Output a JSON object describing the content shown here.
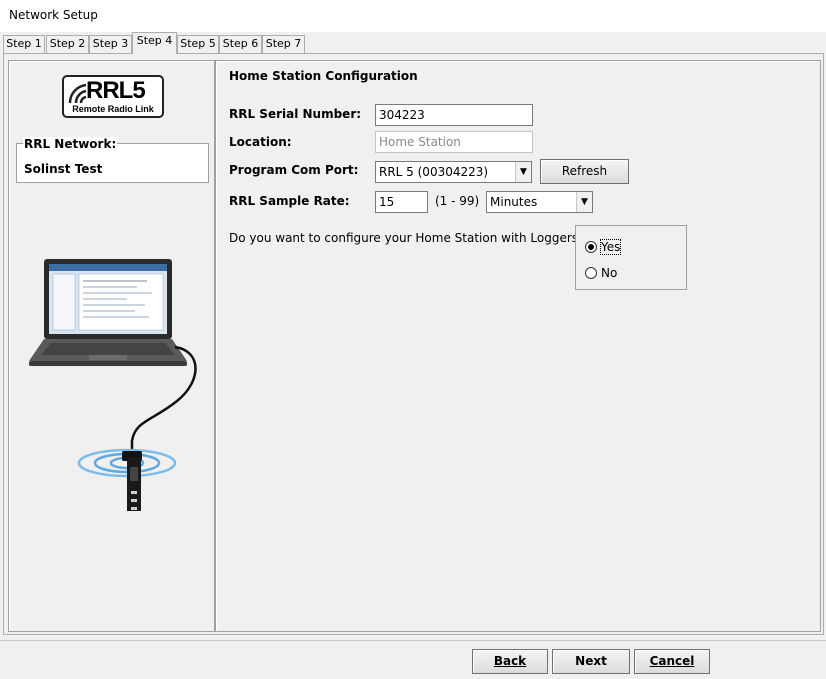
{
  "window": {
    "title": "Network Setup"
  },
  "tabs": [
    {
      "label": "Step 1"
    },
    {
      "label": "Step 2"
    },
    {
      "label": "Step 3"
    },
    {
      "label": "Step 4"
    },
    {
      "label": "Step 5"
    },
    {
      "label": "Step 6"
    },
    {
      "label": "Step 7"
    }
  ],
  "active_tab": "Step 4",
  "left": {
    "logo": {
      "main": "RRL5",
      "sub": "Remote Radio Link"
    },
    "network_label": "RRL Network:",
    "network_value": "Solinst Test"
  },
  "form": {
    "section_title": "Home Station Configuration",
    "serial": {
      "label": "RRL Serial Number:",
      "value": "304223"
    },
    "location": {
      "label": "Location:",
      "placeholder": "Home Station"
    },
    "com_port": {
      "label": "Program Com Port:",
      "value": "RRL 5 (00304223)",
      "refresh_label": "Refresh"
    },
    "sample_rate": {
      "label": "RRL Sample Rate:",
      "value": "15",
      "range": "(1 - 99)",
      "unit": "Minutes"
    },
    "loggers_question": "Do you want to configure your Home Station with Loggers?",
    "options": [
      {
        "label": "Yes",
        "selected": true
      },
      {
        "label": "No",
        "selected": false
      }
    ]
  },
  "footer": {
    "back_label": "Back",
    "next_label": "Next",
    "cancel_label": "Cancel"
  },
  "colors": {
    "window_bg": "#f0f0f0",
    "title_bg": "#ffffff",
    "border": "#a0a0a0"
  }
}
